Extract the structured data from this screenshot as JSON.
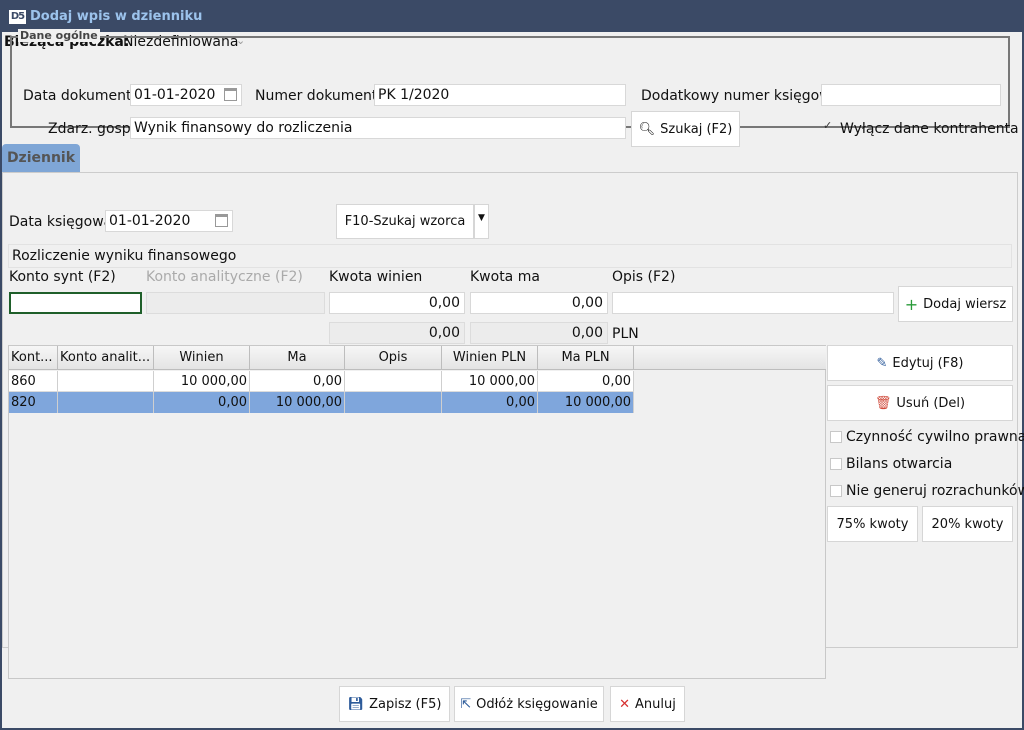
{
  "window": {
    "title": "Dodaj wpis w dzienniku",
    "logo": "D5"
  },
  "batch": {
    "label": "Bieżąca paczka:",
    "value": "Niezdefiniowana"
  },
  "general": {
    "legend": "Dane ogólne",
    "doc_date_label": "Data dokumentu",
    "doc_date": "01-01-2020",
    "doc_number_label": "Numer dokumentu",
    "doc_number": "PK 1/2020",
    "extra_number_label": "Dodatkowy numer księgowy",
    "extra_number": "",
    "event_label": "Zdarz. gosp.",
    "event_value": "Wynik finansowy do rozliczenia",
    "search_button": "Szukaj (F2)",
    "exclude_contractor_label": "Wyłącz dane kontrahenta",
    "exclude_contractor_checked": true
  },
  "tab": {
    "label": "Dziennik"
  },
  "journal": {
    "book_date_label": "Data księgowa",
    "book_date": "01-01-2020",
    "template_button": "F10-Szukaj wzorca",
    "description": "Rozliczenie wyniku finansowego",
    "synt_label": "Konto synt (F2)",
    "anal_label": "Konto analityczne (F2)",
    "debit_label": "Kwota winien",
    "credit_label": "Kwota ma",
    "desc_label": "Opis (F2)",
    "debit_value": "0,00",
    "credit_value": "0,00",
    "debit_total": "0,00",
    "credit_total": "0,00",
    "currency": "PLN",
    "add_row_button": "Dodaj wiersz"
  },
  "grid": {
    "columns": [
      "Kont...",
      "Konto analit...",
      "Winien",
      "Ma",
      "Opis",
      "Winien PLN",
      "Ma PLN"
    ],
    "rows": [
      [
        "860",
        "",
        "10 000,00",
        "0,00",
        "",
        "10 000,00",
        "0,00"
      ],
      [
        "820",
        "",
        "0,00",
        "10 000,00",
        "",
        "0,00",
        "10 000,00"
      ]
    ]
  },
  "side": {
    "edit_button": "Edytuj (F8)",
    "delete_button": "Usuń (Del)",
    "civil_label": "Czynność cywilno prawna",
    "opening_label": "Bilans otwarcia",
    "no_settlements_label": "Nie generuj rozrachunków",
    "pct75_button": "75% kwoty",
    "pct20_button": "20% kwoty"
  },
  "footer": {
    "save_button": "Zapisz (F5)",
    "postpone_button": "Odłóż księgowanie",
    "cancel_button": "Anuluj"
  },
  "colors": {
    "titlebar": "#3b4a66",
    "title_text": "#9cc3ec",
    "selection": "#7fa6dc",
    "tab": "#7fa6d6"
  },
  "icons": [
    "app-logo-icon",
    "calendar-icon",
    "search-icon",
    "dropdown-arrow-icon",
    "plus-icon",
    "edit-icon",
    "trash-icon",
    "save-icon",
    "export-icon",
    "close-x-icon",
    "checkmark-icon"
  ]
}
